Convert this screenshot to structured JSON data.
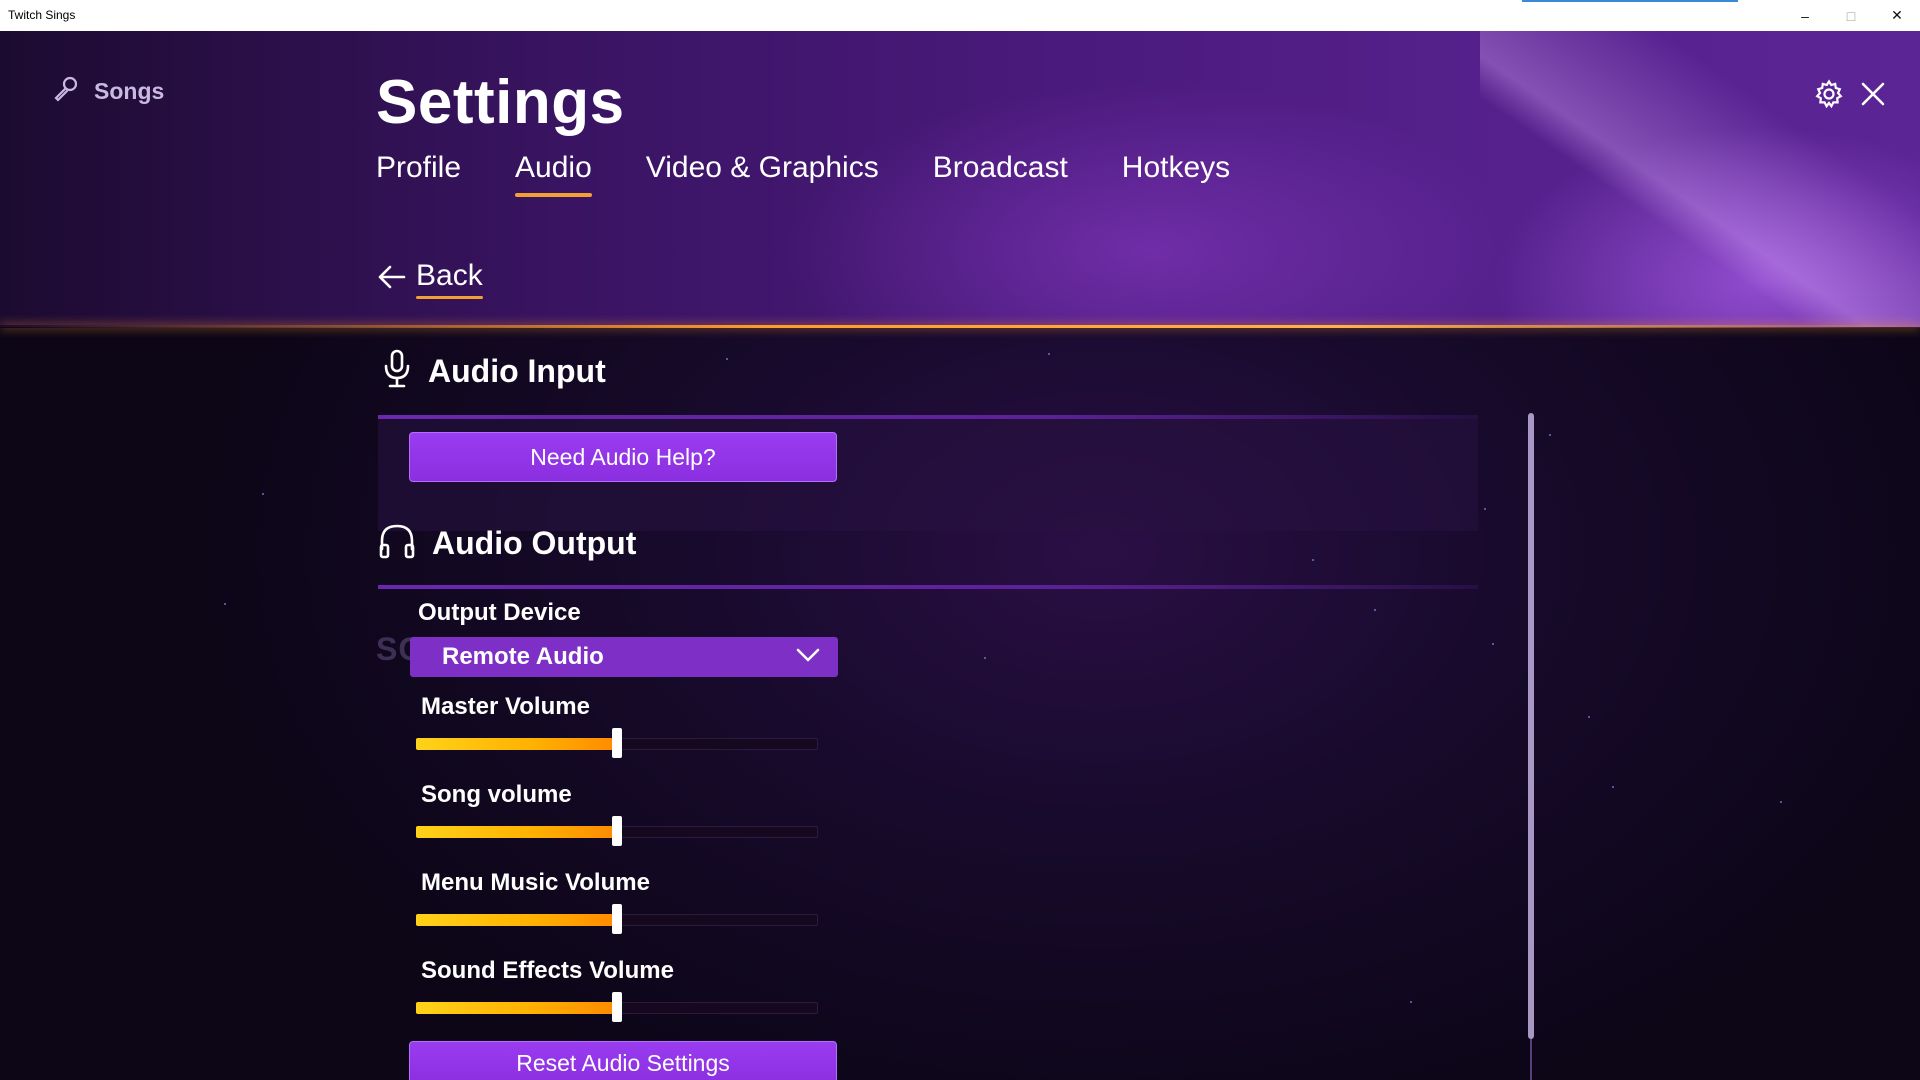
{
  "window": {
    "title": "Twitch Sings",
    "minimize": "–",
    "maximize": "□",
    "close": "✕"
  },
  "nav": {
    "songs_label": "Songs"
  },
  "page": {
    "title": "Settings",
    "back_label": "Back"
  },
  "tabs": [
    {
      "label": "Profile",
      "active": false
    },
    {
      "label": "Audio",
      "active": true
    },
    {
      "label": "Video & Graphics",
      "active": false
    },
    {
      "label": "Broadcast",
      "active": false
    },
    {
      "label": "Hotkeys",
      "active": false
    }
  ],
  "icons": {
    "songs": "microphone-icon",
    "settings": "gear-icon",
    "close": "close-icon",
    "back": "arrow-left-icon"
  },
  "audio_input": {
    "heading": "Audio Input",
    "help_button": "Need Audio Help?"
  },
  "audio_output": {
    "heading": "Audio Output",
    "output_device_label": "Output Device",
    "output_device_value": "Remote Audio",
    "sliders": [
      {
        "label": "Master Volume",
        "value": 0.5
      },
      {
        "label": "Song volume",
        "value": 0.5
      },
      {
        "label": "Menu Music Volume",
        "value": 0.5
      },
      {
        "label": "Sound Effects Volume",
        "value": 0.5
      }
    ],
    "reset_button": "Reset Audio Settings"
  },
  "watermark": "SOFTPEDIA",
  "colors": {
    "accent": "#f2a034",
    "purple": "#8a2fe0",
    "slider_fill": "#ffc000"
  }
}
